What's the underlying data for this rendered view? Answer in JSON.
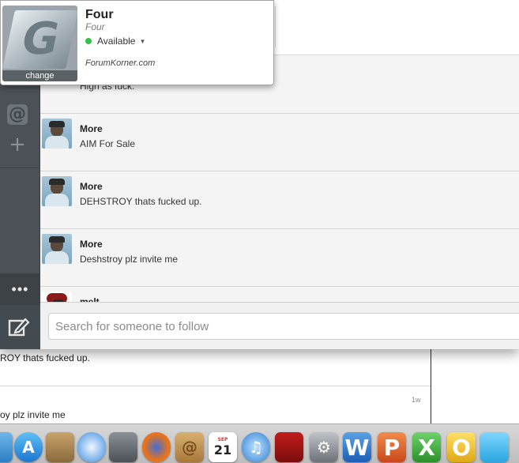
{
  "account": {
    "display_name": "Four",
    "handle": "Four",
    "status": "Available",
    "website": "ForumKorner.com",
    "change_label": "change",
    "logo_letter": "G"
  },
  "sidebar": {
    "mentions_icon": "@",
    "add_icon": "+",
    "more_label": "•••"
  },
  "feed": {
    "partial_text": "High as fuck.",
    "tweets": [
      {
        "name": "More",
        "text": "AIM For Sale"
      },
      {
        "name": "More",
        "text": "DEHSTROY thats fucked up."
      },
      {
        "name": "More",
        "text": "Deshstroy plz invite me"
      },
      {
        "name": "melt",
        "text": ""
      }
    ]
  },
  "search": {
    "placeholder": "Search for someone to follow"
  },
  "background_window": {
    "row1_text": "ROY thats fucked up.",
    "row2_text": "oy plz invite me",
    "row2_time": "1w"
  },
  "dock": {
    "icons": [
      "finder-icon",
      "app-store-icon",
      "preview-icon",
      "safari-icon",
      "facetime-icon",
      "firefox-icon",
      "address-book-icon",
      "calendar-icon",
      "itunes-icon",
      "photo-booth-icon",
      "system-preferences-icon",
      "word-icon",
      "powerpoint-icon",
      "excel-icon",
      "outlook-icon",
      "messenger-icon"
    ],
    "calendar_day": "21",
    "calendar_month": "SEP"
  }
}
